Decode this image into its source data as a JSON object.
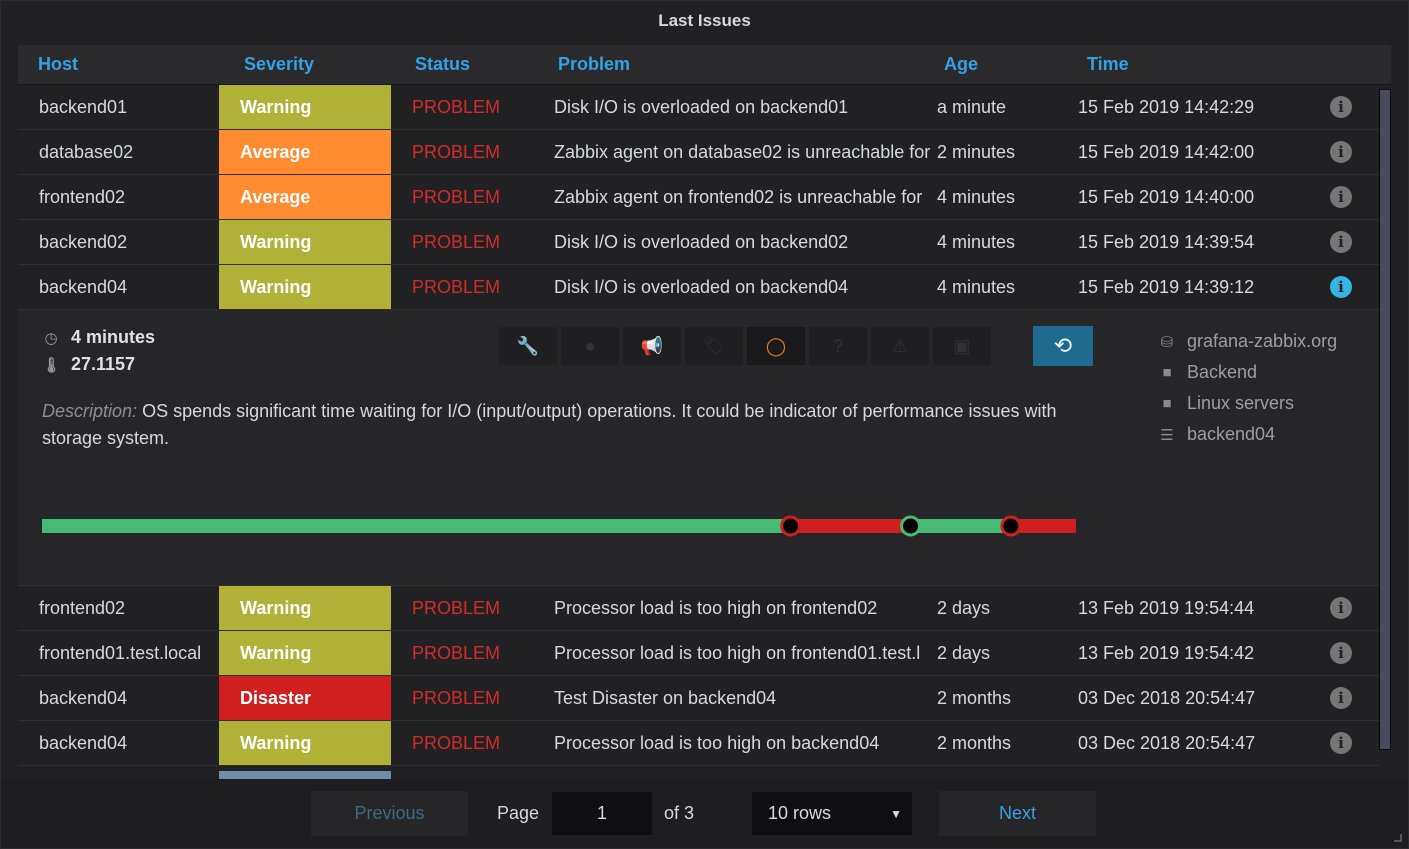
{
  "panel": {
    "title": "Last Issues"
  },
  "columns": [
    "Host",
    "Severity",
    "Status",
    "Problem",
    "Age",
    "Time"
  ],
  "colors": {
    "Warning": "#b0b237",
    "Average": "#ff8c30",
    "Disaster": "#d11f1f",
    "problem_text": "#d12b2b",
    "header_text": "#33a2e5",
    "accent_blue": "#33b5e5"
  },
  "rows_top": [
    {
      "host": "backend01",
      "severity": "Warning",
      "status": "PROBLEM",
      "problem": "Disk I/O is overloaded on backend01",
      "age": "a minute",
      "time": "15 Feb 2019 14:42:29",
      "info_icon": "info-icon"
    },
    {
      "host": "database02",
      "severity": "Average",
      "status": "PROBLEM",
      "problem": "Zabbix agent on database02 is unreachable for",
      "age": "2 minutes",
      "time": "15 Feb 2019 14:42:00",
      "info_icon": "info-icon"
    },
    {
      "host": "frontend02",
      "severity": "Average",
      "status": "PROBLEM",
      "problem": "Zabbix agent on frontend02 is unreachable for",
      "age": "4 minutes",
      "time": "15 Feb 2019 14:40:00",
      "info_icon": "info-icon"
    },
    {
      "host": "backend02",
      "severity": "Warning",
      "status": "PROBLEM",
      "problem": "Disk I/O is overloaded on backend02",
      "age": "4 minutes",
      "time": "15 Feb 2019 14:39:54",
      "info_icon": "info-icon"
    },
    {
      "host": "backend04",
      "severity": "Warning",
      "status": "PROBLEM",
      "problem": "Disk I/O is overloaded on backend04",
      "age": "4 minutes",
      "time": "15 Feb 2019 14:39:12",
      "info_icon": "info-icon",
      "expanded": true
    }
  ],
  "details": {
    "age": "4 minutes",
    "value": "27.1157",
    "description_label": "Description:",
    "description": "OS spends significant time waiting for I/O (input/output) operations. It could be indicator of performance issues with storage system.",
    "toolbar_icons": [
      "wrench-icon",
      "globe-icon",
      "bullhorn-icon",
      "tag-icon",
      "circle-notch-icon",
      "question-icon",
      "warning-icon",
      "square-icon"
    ],
    "active_toolbar_icon": "circle-notch-icon",
    "ack_icon": "reply-all-icon",
    "tags": [
      {
        "icon": "database-icon",
        "label": "grafana-zabbix.org"
      },
      {
        "icon": "folder-icon",
        "label": "Backend"
      },
      {
        "icon": "folder-icon",
        "label": "Linux servers"
      },
      {
        "icon": "server-icon",
        "label": "backend04"
      }
    ],
    "timeline": {
      "segments": [
        {
          "from": 0.0,
          "to": 0.724,
          "state": "ok"
        },
        {
          "from": 0.724,
          "to": 0.84,
          "state": "problem"
        },
        {
          "from": 0.84,
          "to": 0.937,
          "state": "ok"
        },
        {
          "from": 0.937,
          "to": 1.0,
          "state": "problem"
        }
      ],
      "events": [
        {
          "pos": 0.724,
          "state": "problem"
        },
        {
          "pos": 0.84,
          "state": "ok"
        },
        {
          "pos": 0.937,
          "state": "problem"
        }
      ],
      "colors": {
        "ok": "#47bb73",
        "problem": "#d11f1f"
      }
    }
  },
  "rows_bottom": [
    {
      "host": "frontend02",
      "severity": "Warning",
      "status": "PROBLEM",
      "problem": "Processor load is too high on frontend02",
      "age": "2 days",
      "time": "13 Feb 2019 19:54:44",
      "info_icon": "info-icon"
    },
    {
      "host": "frontend01.test.local",
      "severity": "Warning",
      "status": "PROBLEM",
      "problem": "Processor load is too high on frontend01.test.l",
      "age": "2 days",
      "time": "13 Feb 2019 19:54:42",
      "info_icon": "info-icon"
    },
    {
      "host": "backend04",
      "severity": "Disaster",
      "status": "PROBLEM",
      "problem": "Test Disaster on backend04",
      "age": "2 months",
      "time": "03 Dec 2018 20:54:47",
      "info_icon": "info-icon"
    },
    {
      "host": "backend04",
      "severity": "Warning",
      "status": "PROBLEM",
      "problem": "Processor load is too high on backend04",
      "age": "2 months",
      "time": "03 Dec 2018 20:54:47",
      "info_icon": "info-icon"
    }
  ],
  "pagination": {
    "previous_label": "Previous",
    "page_label": "Page",
    "current_page": "1",
    "of_label": "of 3",
    "rows_option": "10 rows",
    "next_label": "Next"
  }
}
